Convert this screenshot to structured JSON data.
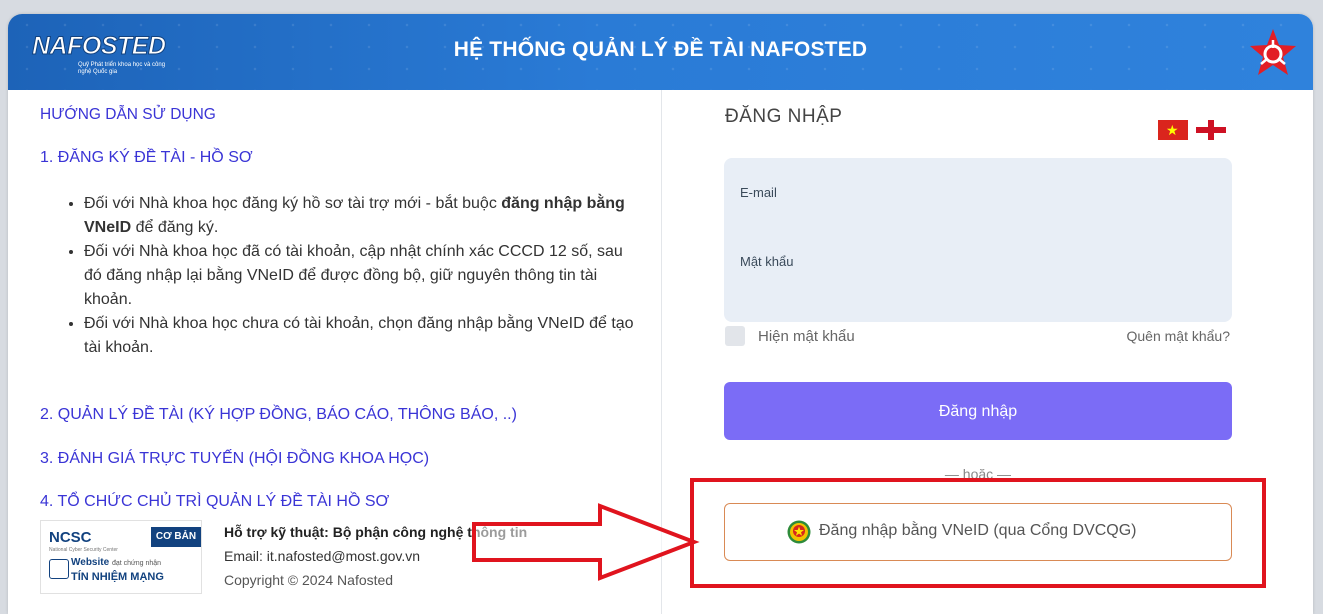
{
  "header": {
    "logo_text": "NAFOSTED",
    "logo_subtitle": "Quỹ Phát triển khoa học và công nghệ Quốc gia",
    "title": "HỆ THỐNG QUẢN LÝ ĐỀ TÀI NAFOSTED"
  },
  "guide": {
    "title": "HƯỚNG DẪN SỬ DỤNG",
    "section1": "1. ĐĂNG KÝ ĐỀ TÀI - HỒ SƠ",
    "bullet1_pre": "Đối với Nhà khoa học đăng ký hồ sơ tài trợ mới - bắt buộc ",
    "bullet1_bold": "đăng nhập bằng VNeID",
    "bullet1_post": " để đăng ký.",
    "bullet2": "Đối với Nhà khoa học đã có tài khoản, cập nhật chính xác CCCD 12 số, sau đó đăng nhập lại bằng VNeID để được đồng bộ, giữ nguyên thông tin tài khoản.",
    "bullet3": "Đối với Nhà khoa học chưa có tài khoản, chọn đăng nhập bằng VNeID để tạo tài khoản.",
    "section2": "2. QUẢN LÝ ĐỀ TÀI (KÝ HỢP ĐỒNG, BÁO CÁO, THÔNG BÁO, ..)",
    "section3": "3. ĐÁNH GIÁ TRỰC TUYẾN (HỘI ĐỒNG KHOA HỌC)",
    "section4": "4. TỔ CHỨC CHỦ TRÌ QUẢN LÝ ĐỀ TÀI HỒ SƠ"
  },
  "badge": {
    "ncsc": "NCSC",
    "ncsc_sub": "National Cyber Security Center",
    "level": "CƠ BẢN",
    "website": "Website",
    "website_small": "đạt chứng nhận",
    "tnm": "TÍN NHIỆM MẠNG"
  },
  "footer": {
    "support": "Hỗ trợ kỹ thuật: Bộ phận công nghệ thông tin",
    "email": "Email: it.nafosted@most.gov.vn",
    "copyright_pre": "Copyright © 2024 ",
    "copyright_org": "Nafosted"
  },
  "login": {
    "title": "ĐĂNG NHẬP",
    "email_label": "E-mail",
    "password_label": "Mật khẩu",
    "show_password": "Hiện mật khẩu",
    "forgot": "Quên mật khẩu?",
    "submit": "Đăng nhập",
    "or": "— hoặc —",
    "vneid": "Đăng nhập bằng VNeID (qua Cổng DVCQG)"
  },
  "colors": {
    "header": "#2a7bd6",
    "accent": "#3a34d6",
    "button": "#7b6cf6",
    "annotation": "#e0141e"
  }
}
